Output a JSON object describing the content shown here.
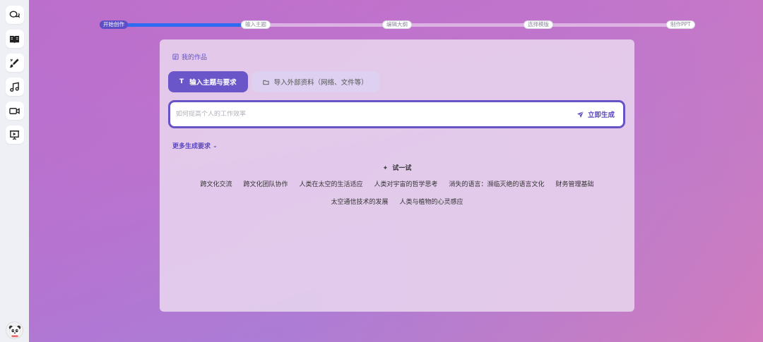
{
  "steps": [
    {
      "label": "开始创作",
      "active": true
    },
    {
      "label": "输入主题",
      "active": false
    },
    {
      "label": "编辑大纲",
      "active": false
    },
    {
      "label": "选择模版",
      "active": false
    },
    {
      "label": "制作PPT",
      "active": false
    }
  ],
  "progress_fraction": 0.24,
  "sidebar": {
    "items": [
      {
        "icon": "chat-icon"
      },
      {
        "icon": "book-icon"
      },
      {
        "icon": "pen-brush-icon"
      },
      {
        "icon": "music-icon"
      },
      {
        "icon": "video-icon"
      },
      {
        "icon": "presentation-icon"
      }
    ],
    "avatar_icon": "panda-avatar-icon"
  },
  "card": {
    "my_works": "我的作品",
    "tabs": [
      {
        "label": "输入主题与要求",
        "icon": "T"
      },
      {
        "label": "导入外部资料（网络、文件等）",
        "icon": "folder-icon"
      }
    ],
    "input": {
      "placeholder": "如何提高个人的工作效率",
      "value": ""
    },
    "generate_label": "立即生成",
    "more_label": "更多生成要求",
    "try_label": "试一试",
    "suggestions_row1": [
      "跨文化交流",
      "跨文化团队协作",
      "人类在太空的生活适应",
      "人类对宇宙的哲学思考",
      "消失的语言：濒临灭绝的语言文化",
      "财务管理基础"
    ],
    "suggestions_row2": [
      "太空通信技术的发展",
      "人类与植物的心灵感应"
    ]
  },
  "colors": {
    "accent": "#6653c6",
    "progress_fill": "#2e6bf0"
  }
}
